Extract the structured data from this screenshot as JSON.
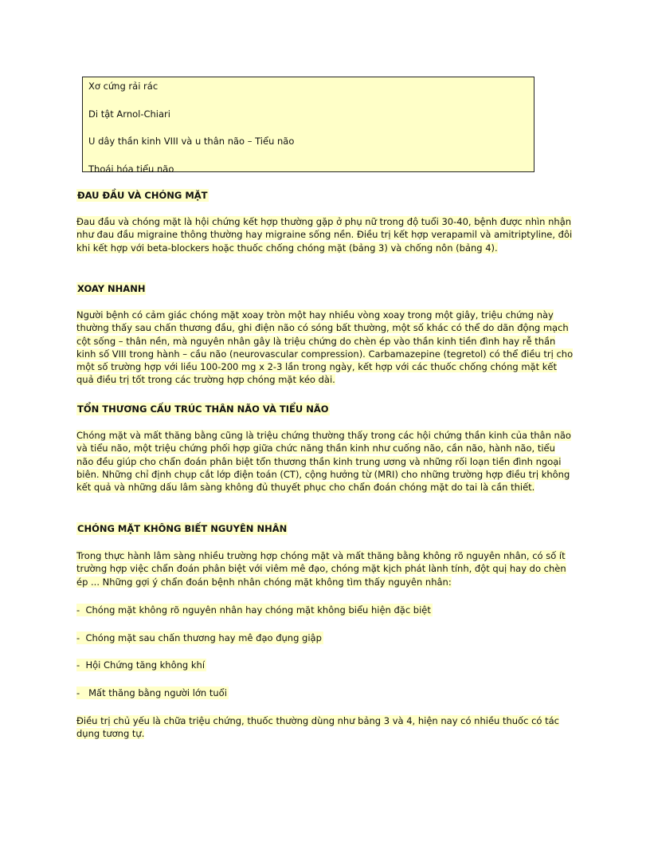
{
  "box": {
    "lines": [
      "Xơ cứng rải rác",
      "Di tật Arnol-Chiari",
      "U dây thần kinh VIII và u thân não – Tiểu não",
      "Thoái hóa tiểu não"
    ]
  },
  "sections": [
    {
      "heading": "ĐAU ĐẦU VÀ CHÓNG MẶT",
      "paragraph": "Đau đầu và chóng mặt là hội chứng kết hợp thường gặp ở phụ nữ trong độ tuổi 30-40, bệnh được nhìn nhận như đau đầu migraine thông thường hay migraine sống nền. Điều trị kết hợp verapamil và amitriptyline, đôi khi kết hợp với beta-blockers hoặc thuốc chống chóng mặt (bảng 3) và chống nôn (bảng 4)."
    },
    {
      "heading": "XOAY NHANH",
      "paragraph": "Người bệnh có cảm giác chóng mặt xoay tròn một hay nhiều vòng xoay trong một giây, triệu chứng này thường thấy sau chấn thương đầu, ghi điện não có sóng bất thường, một số khác có thể do dãn động mạch cột sống – thân nền, mà nguyên nhân gây là triệu chứng do chèn ép vào thần kinh tiền đình hay rễ thần kinh số VIII trong hành – cầu não (neurovascular compression). Carbamazepine (tegretol) có thể điều trị cho một số trường hợp với liều 100-200 mg x 2-3 lần trong ngày, kết hợp với các thuốc chống chóng mặt kết quả điều trị tốt trong các trường hợp chóng mặt kéo dài."
    },
    {
      "heading": "TỔN THƯƠNG CẤU TRÚC THÂN NÃO VÀ TIỂU NÃO",
      "paragraph": "Chóng mặt và mất thăng bằng cũng là triệu chứng thường thấy trong các hội chứng thần kinh của thân não và tiểu não, một triệu chứng phối hợp giữa chức năng thần kinh như cuống não, cần não, hành não, tiểu não đều giúp cho chẩn đoán phân biệt tổn thương thần kinh trung ương và những rối loạn tiền đình ngoại biên. Những chỉ định chụp cắt lớp điện toán (CT), cộng hưởng từ (MRI) cho những trường hợp điều trị không kết quả và những dấu lâm sàng không đủ thuyết phục cho chẩn đoán chóng mặt do tai là cần thiết."
    },
    {
      "heading": "CHÓNG MẶT KHÔNG BIẾT NGUYÊN NHÂN",
      "paragraph": "Trong thực hành lâm sàng nhiều trường hợp chóng mặt và mất thăng bằng không rõ nguyên nhân, có số ít trường hợp việc chẩn đoán phân biệt với viêm mê đạo, chóng mặt kịch phát lành tính, đột quị hay do chèn ép ... Những gợi ý chẩn đoán bệnh nhân chóng mặt không tìm thấy nguyên nhân:"
    }
  ],
  "bullets": [
    "-  Chóng mặt không rõ nguyên nhân hay chóng mặt không biểu hiện đặc biệt",
    "-  Chóng mặt sau chấn thương hay mê đạo đụng giập",
    "-  Hội Chứng tăng không khí",
    "-   Mất thăng bằng người lớn tuổi"
  ],
  "closing": "Điều trị chủ yếu là chữa triệu chứng, thuốc thường dùng như bảng 3 và 4, hiện nay có nhiều thuốc có tác dụng tương tự.",
  "colors": {
    "highlight": "#ffffc8",
    "text": "#111111",
    "border": "#222222"
  }
}
